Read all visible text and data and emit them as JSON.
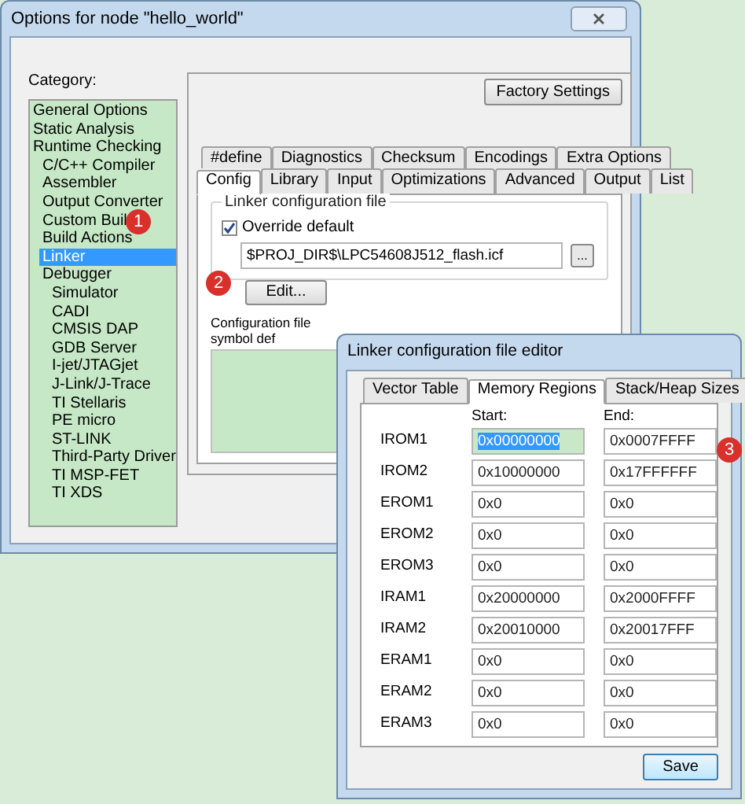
{
  "options_dialog": {
    "title": "Options for node \"hello_world\"",
    "category_label": "Category:",
    "categories": [
      {
        "label": "General Options",
        "selected": false
      },
      {
        "label": "Static Analysis",
        "selected": false
      },
      {
        "label": "Runtime Checking",
        "selected": false,
        "children": [
          {
            "label": "C/C++ Compiler",
            "selected": false
          },
          {
            "label": "Assembler",
            "selected": false
          },
          {
            "label": "Output Converter",
            "selected": false
          },
          {
            "label": "Custom Buil",
            "selected": false
          },
          {
            "label": "Build Actions",
            "selected": false
          },
          {
            "label": "Linker",
            "selected": true
          },
          {
            "label": "Debugger",
            "selected": false,
            "children": [
              {
                "label": "Simulator",
                "selected": false
              },
              {
                "label": "CADI",
                "selected": false
              },
              {
                "label": "CMSIS DAP",
                "selected": false
              },
              {
                "label": "GDB Server",
                "selected": false
              },
              {
                "label": "I-jet/JTAGjet",
                "selected": false
              },
              {
                "label": "J-Link/J-Trace",
                "selected": false
              },
              {
                "label": "TI Stellaris",
                "selected": false
              },
              {
                "label": "PE micro",
                "selected": false
              },
              {
                "label": "ST-LINK",
                "selected": false
              },
              {
                "label": "Third-Party Driver",
                "selected": false
              },
              {
                "label": "TI MSP-FET",
                "selected": false
              },
              {
                "label": "TI XDS",
                "selected": false
              }
            ]
          }
        ]
      }
    ],
    "factory_settings_button": "Factory Settings",
    "tabs_row_1": [
      {
        "label": "#define",
        "selected": false
      },
      {
        "label": "Diagnostics",
        "selected": false
      },
      {
        "label": "Checksum",
        "selected": false
      },
      {
        "label": "Encodings",
        "selected": false
      },
      {
        "label": "Extra Options",
        "selected": false
      }
    ],
    "tabs_row_2": [
      {
        "label": "Config",
        "selected": true
      },
      {
        "label": "Library",
        "selected": false
      },
      {
        "label": "Input",
        "selected": false
      },
      {
        "label": "Optimizations",
        "selected": false
      },
      {
        "label": "Advanced",
        "selected": false
      },
      {
        "label": "Output",
        "selected": false
      },
      {
        "label": "List",
        "selected": false
      }
    ],
    "linker_group": {
      "title": "Linker configuration file",
      "override_default": {
        "label": "Override default",
        "checked": true
      },
      "path": "$PROJ_DIR$\\LPC54608J512_flash.icf",
      "browse_button": "...",
      "edit_button": "Edit..."
    },
    "symbol_definitions_label": "Configuration file symbol def"
  },
  "editor": {
    "title": "Linker configuration file editor",
    "tabs": [
      {
        "label": "Vector Table",
        "selected": false
      },
      {
        "label": "Memory Regions",
        "selected": true
      },
      {
        "label": "Stack/Heap Sizes",
        "selected": false
      }
    ],
    "start_header": "Start:",
    "end_header": "End:",
    "regions": [
      {
        "name": "IROM1",
        "start": "0x00000000",
        "end": "0x0007FFFF",
        "start_selected": true
      },
      {
        "name": "IROM2",
        "start": "0x10000000",
        "end": "0x17FFFFFF",
        "start_selected": false
      },
      {
        "name": "EROM1",
        "start": "0x0",
        "end": "0x0",
        "start_selected": false
      },
      {
        "name": "EROM2",
        "start": "0x0",
        "end": "0x0",
        "start_selected": false
      },
      {
        "name": "EROM3",
        "start": "0x0",
        "end": "0x0",
        "start_selected": false
      },
      {
        "name": "IRAM1",
        "start": "0x20000000",
        "end": "0x2000FFFF",
        "start_selected": false
      },
      {
        "name": "IRAM2",
        "start": "0x20010000",
        "end": "0x20017FFF",
        "start_selected": false
      },
      {
        "name": "ERAM1",
        "start": "0x0",
        "end": "0x0",
        "start_selected": false
      },
      {
        "name": "ERAM2",
        "start": "0x0",
        "end": "0x0",
        "start_selected": false
      },
      {
        "name": "ERAM3",
        "start": "0x0",
        "end": "0x0",
        "start_selected": false
      }
    ],
    "save_button": "Save"
  },
  "annotations": [
    {
      "label": "1"
    },
    {
      "label": "2"
    },
    {
      "label": "3"
    }
  ]
}
